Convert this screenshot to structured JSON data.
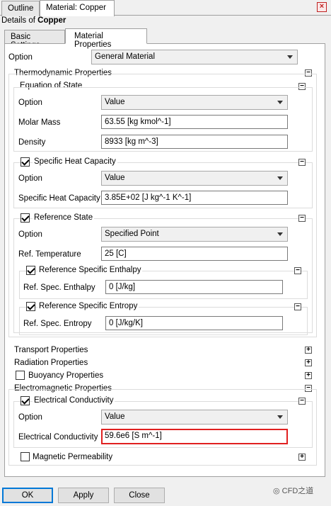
{
  "tabs": [
    "Outline",
    "Material: Copper"
  ],
  "details": {
    "prefix": "Details of ",
    "name": "Copper"
  },
  "subtabs": [
    "Basic Settings",
    "Material Properties"
  ],
  "option": {
    "label": "Option",
    "value": "General Material"
  },
  "thermo": {
    "title": "Thermodynamic Properties"
  },
  "eos": {
    "title": "Equation of State",
    "option_label": "Option",
    "option_value": "Value",
    "molar_label": "Molar Mass",
    "molar_value": "63.55 [kg kmol^-1]",
    "density_label": "Density",
    "density_value": "8933 [kg m^-3]"
  },
  "heat": {
    "title": "Specific Heat Capacity",
    "option_label": "Option",
    "option_value": "Value",
    "cap_label": "Specific Heat Capacity",
    "cap_value": "3.85E+02 [J kg^-1 K^-1]"
  },
  "ref": {
    "title": "Reference State",
    "option_label": "Option",
    "option_value": "Specified Point",
    "temp_label": "Ref. Temperature",
    "temp_value": "25 [C]",
    "enthalpy_title": "Reference Specific Enthalpy",
    "enthalpy_label": "Ref. Spec. Enthalpy",
    "enthalpy_value": "0 [J/kg]",
    "entropy_title": "Reference Specific Entropy",
    "entropy_label": "Ref. Spec. Entropy",
    "entropy_value": "0 [J/kg/K]"
  },
  "sections": {
    "transport": "Transport Properties",
    "radiation": "Radiation Properties",
    "buoyancy": "Buoyancy Properties",
    "em": "Electromagnetic Properties"
  },
  "elec": {
    "title": "Electrical Conductivity",
    "option_label": "Option",
    "option_value": "Value",
    "cond_label": "Electrical Conductivity",
    "cond_value": "59.6e6 [S m^-1]"
  },
  "magnetic": {
    "title": "Magnetic Permeability"
  },
  "buttons": {
    "ok": "OK",
    "apply": "Apply",
    "close": "Close"
  },
  "watermark": "CFD之道",
  "colors": {
    "highlight": "#e02020",
    "default_button": "#0078d7"
  }
}
